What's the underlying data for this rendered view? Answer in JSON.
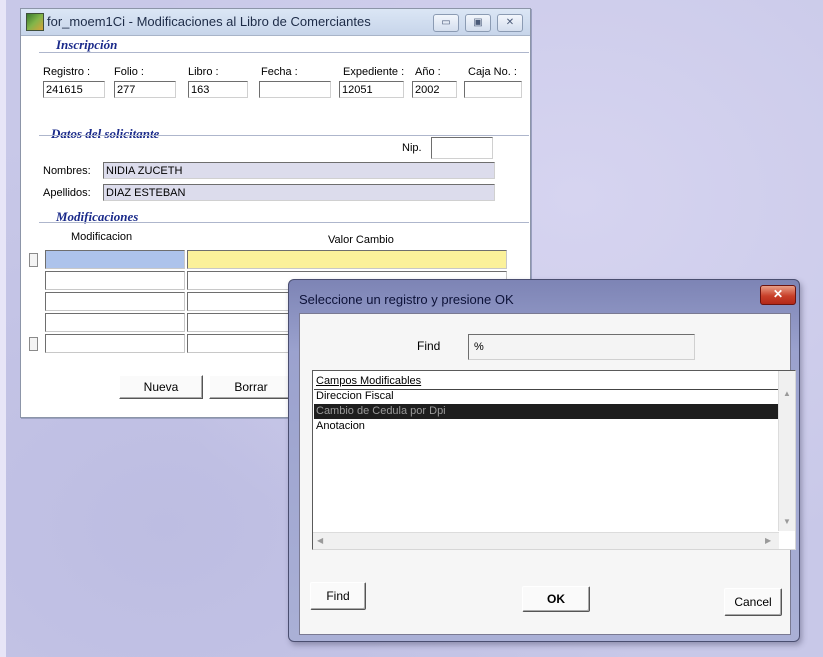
{
  "main_window": {
    "title": "for_moem1Ci - Modificaciones al Libro de Comerciantes",
    "title_buttons": [
      "▭",
      "▣",
      "✕"
    ],
    "sections": {
      "inscripcion": "Inscripción",
      "solicitante": "Datos del solicitante",
      "modificaciones": "Modificaciones"
    },
    "fields": {
      "registro": {
        "label": "Registro :",
        "value": "241615"
      },
      "folio": {
        "label": "Folio :",
        "value": "277"
      },
      "libro": {
        "label": "Libro :",
        "value": "163"
      },
      "fecha": {
        "label": "Fecha :",
        "value": ""
      },
      "expediente": {
        "label": "Expediente :",
        "value": "12051"
      },
      "anio": {
        "label": "Año :",
        "value": "2002"
      },
      "caja": {
        "label": "Caja No. :",
        "value": ""
      },
      "nip": {
        "label": "Nip.",
        "value": ""
      },
      "nombres": {
        "label": "Nombres:",
        "value": "NIDIA ZUCETH"
      },
      "apellidos": {
        "label": "Apellidos:",
        "value": "DIAZ ESTEBAN"
      }
    },
    "grid": {
      "columns": [
        "Modificacion",
        "Valor Cambio"
      ],
      "row_count": 5
    },
    "buttons": {
      "nueva": "Nueva",
      "borrar": "Borrar"
    }
  },
  "dialog": {
    "title": "Seleccione un registro y presione OK",
    "find_label": "Find",
    "find_value": "%",
    "list_header": "Campos Modificables",
    "items": [
      "Direccion Fiscal",
      "Cambio de Cedula por Dpi",
      "Anotacion"
    ],
    "selected_index": 1,
    "buttons": {
      "find": "Find",
      "ok": "OK",
      "cancel": "Cancel"
    },
    "close_glyph": "✕"
  }
}
